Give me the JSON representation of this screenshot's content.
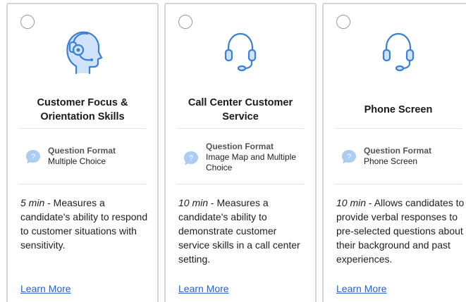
{
  "cards": [
    {
      "title": "Customer Focus & Orientation Skills",
      "icon": "customer-profile-headset-icon",
      "question_format_label": "Question Format",
      "question_format_value": "Multiple Choice",
      "time": "5 min",
      "description": " - Measures a candidate's ability to respond to customer situations with sensitivity.",
      "link": "Learn More"
    },
    {
      "title": "Call Center Customer Service",
      "icon": "headset-icon",
      "question_format_label": "Question Format",
      "question_format_value": "Image Map and Multiple Choice",
      "time": "10 min",
      "description": " - Measures a candidate's ability to demonstrate customer service skills in a call center setting.",
      "link": "Learn More"
    },
    {
      "title": "Phone Screen",
      "icon": "headset-icon",
      "question_format_label": "Question Format",
      "question_format_value": "Phone Screen",
      "time": "10 min",
      "description": " - Allows candidates to provide verbal responses to pre-selected questions about their background and past experiences.",
      "link": "Learn More"
    }
  ],
  "colors": {
    "icon_stroke": "#3b7fd4",
    "icon_fill": "#cfe3fb",
    "bubble_fill": "#a9cdf3",
    "link": "#2a62c9",
    "border": "#d6d6d6"
  }
}
